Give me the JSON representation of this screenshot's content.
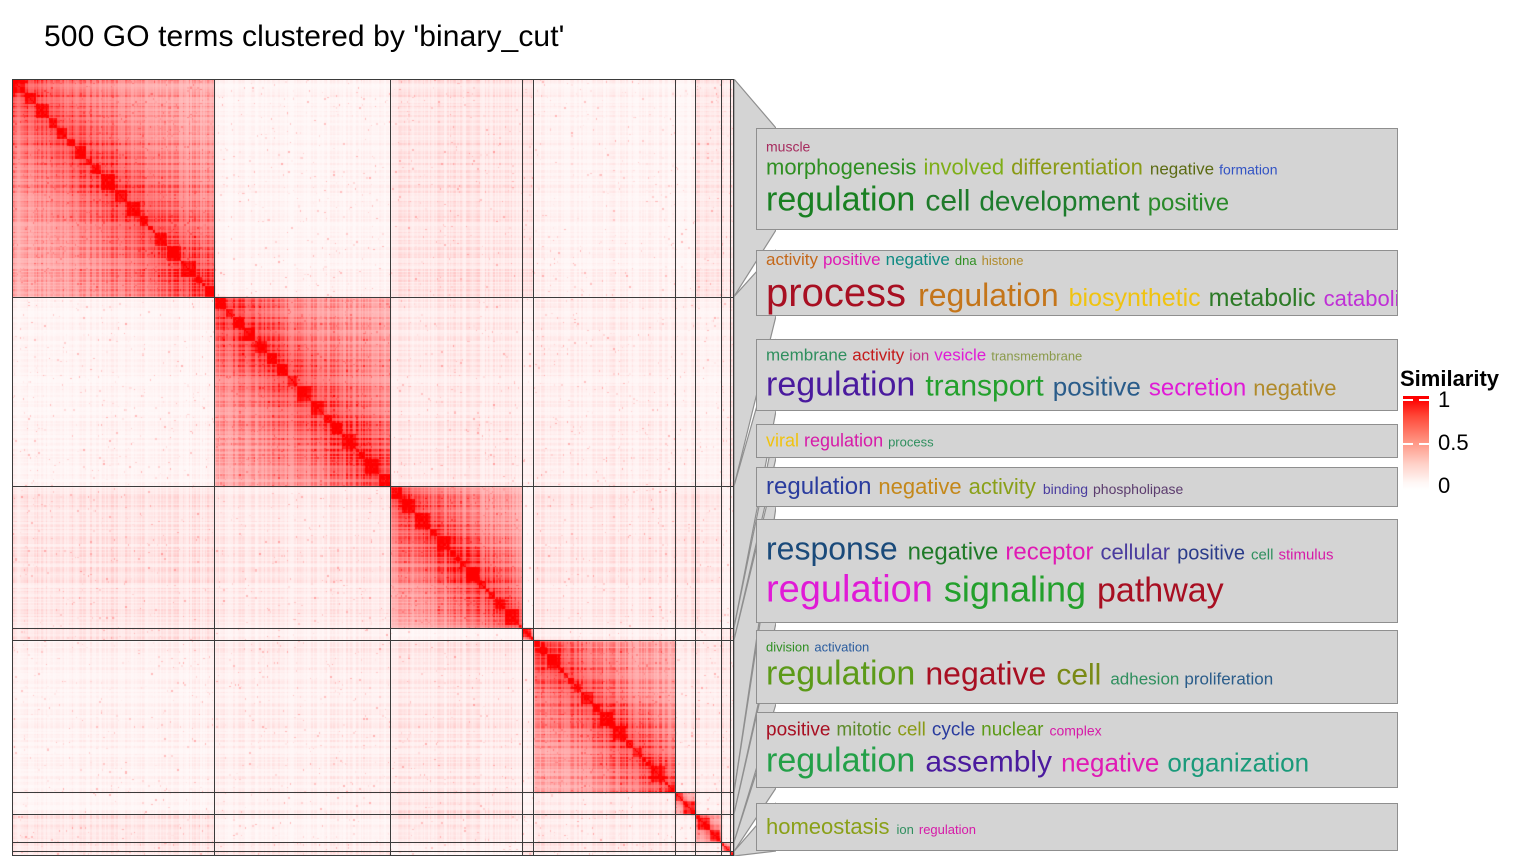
{
  "title": "500 GO terms clustered by 'binary_cut'",
  "legend": {
    "title": "Similarity",
    "ticks": [
      "1",
      "0.5",
      "0"
    ],
    "low_color": "#ffffff",
    "high_color": "#fe0000"
  },
  "heatmap": {
    "n_terms": 500,
    "clustering_method": "binary_cut",
    "cluster_sizes": [
      140,
      122,
      91,
      8,
      98,
      14,
      18,
      6,
      3
    ],
    "grid_color": "#3b3b3b",
    "background": "#ffffff"
  },
  "chart_data": {
    "type": "heatmap",
    "title": "500 GO terms clustered by 'binary_cut'",
    "xlabel": "",
    "ylabel": "",
    "colorbar": {
      "label": "Similarity",
      "ticks": [
        0,
        0.5,
        1
      ],
      "range": [
        0,
        1
      ],
      "colors": [
        "#ffffff",
        "#fe0000"
      ]
    },
    "clusters": [
      {
        "id": 1,
        "size": 140,
        "start": 0,
        "end": 140
      },
      {
        "id": 2,
        "size": 122,
        "start": 140,
        "end": 262
      },
      {
        "id": 3,
        "size": 91,
        "start": 262,
        "end": 353
      },
      {
        "id": 4,
        "size": 8,
        "start": 353,
        "end": 361
      },
      {
        "id": 5,
        "size": 98,
        "start": 361,
        "end": 459
      },
      {
        "id": 6,
        "size": 14,
        "start": 459,
        "end": 473
      },
      {
        "id": 7,
        "size": 18,
        "start": 473,
        "end": 491
      },
      {
        "id": 8,
        "size": 6,
        "start": 491,
        "end": 497
      },
      {
        "id": 9,
        "size": 3,
        "start": 497,
        "end": 500
      }
    ]
  },
  "panels": [
    {
      "id": "panel-1",
      "lines": [
        [
          {
            "t": "muscle",
            "size": 14,
            "color": "#a62b5e"
          }
        ],
        [
          {
            "t": "morphogenesis",
            "size": 22,
            "color": "#2f8f22"
          },
          {
            "t": "involved",
            "size": 22,
            "color": "#7fae18"
          },
          {
            "t": "differentiation",
            "size": 22,
            "color": "#8a9a16"
          },
          {
            "t": "negative",
            "size": 17,
            "color": "#5c6b13"
          },
          {
            "t": "formation",
            "size": 14,
            "color": "#3253c4"
          }
        ],
        [
          {
            "t": "regulation",
            "size": 34,
            "color": "#198022"
          },
          {
            "t": "cell",
            "size": 30,
            "color": "#1f7a2a"
          },
          {
            "t": "development",
            "size": 28,
            "color": "#1d7c2c"
          },
          {
            "t": "positive",
            "size": 24,
            "color": "#2a8a2a"
          }
        ]
      ]
    },
    {
      "id": "panel-2",
      "lines": [
        [
          {
            "t": "activity",
            "size": 17,
            "color": "#c4681a"
          },
          {
            "t": "positive",
            "size": 17,
            "color": "#e01ab4"
          },
          {
            "t": "negative",
            "size": 17,
            "color": "#0f8a82"
          },
          {
            "t": "dna",
            "size": 13,
            "color": "#2f8f22"
          },
          {
            "t": "histone",
            "size": 13,
            "color": "#b08a2a"
          }
        ],
        [
          {
            "t": "process",
            "size": 40,
            "color": "#a80f22"
          },
          {
            "t": "regulation",
            "size": 32,
            "color": "#c4751a"
          },
          {
            "t": "biosynthetic",
            "size": 25,
            "color": "#f0c310"
          },
          {
            "t": "metabolic",
            "size": 25,
            "color": "#2c7a26"
          },
          {
            "t": "catabolic",
            "size": 22,
            "color": "#bf2fd6"
          }
        ]
      ]
    },
    {
      "id": "panel-3",
      "lines": [
        [
          {
            "t": "membrane",
            "size": 17,
            "color": "#2f8f5e"
          },
          {
            "t": "activity",
            "size": 17,
            "color": "#c41a1a"
          },
          {
            "t": "ion",
            "size": 15,
            "color": "#c42f8a"
          },
          {
            "t": "vesicle",
            "size": 17,
            "color": "#e01ad6"
          },
          {
            "t": "transmembrane",
            "size": 13,
            "color": "#8a9a4a"
          }
        ],
        [
          {
            "t": "regulation",
            "size": 34,
            "color": "#4a1a9e"
          },
          {
            "t": "transport",
            "size": 30,
            "color": "#23a02c"
          },
          {
            "t": "positive",
            "size": 26,
            "color": "#2a5c8a"
          },
          {
            "t": "secretion",
            "size": 24,
            "color": "#e01ad6"
          },
          {
            "t": "negative",
            "size": 22,
            "color": "#b08a2a"
          }
        ]
      ]
    },
    {
      "id": "panel-4",
      "lines": [
        [
          {
            "t": "viral",
            "size": 18,
            "color": "#f0c310"
          },
          {
            "t": "regulation",
            "size": 18,
            "color": "#d61aa8"
          },
          {
            "t": "process",
            "size": 13,
            "color": "#2f8f5e"
          }
        ]
      ]
    },
    {
      "id": "panel-5",
      "lines": [
        [
          {
            "t": "regulation",
            "size": 24,
            "color": "#2a3c9e"
          },
          {
            "t": "negative",
            "size": 22,
            "color": "#c4881a"
          },
          {
            "t": "activity",
            "size": 22,
            "color": "#8aa018"
          },
          {
            "t": "binding",
            "size": 14,
            "color": "#4a3c9e"
          },
          {
            "t": "phospholipase",
            "size": 14,
            "color": "#5c3c6e"
          }
        ]
      ]
    },
    {
      "id": "panel-6",
      "lines": [
        [
          {
            "t": "response",
            "size": 32,
            "color": "#1a4a7a"
          },
          {
            "t": "negative",
            "size": 24,
            "color": "#1f7a28"
          },
          {
            "t": "receptor",
            "size": 24,
            "color": "#e01ab4"
          },
          {
            "t": "cellular",
            "size": 22,
            "color": "#4a3c9e"
          },
          {
            "t": "positive",
            "size": 20,
            "color": "#2a3c8a"
          },
          {
            "t": "cell",
            "size": 15,
            "color": "#2f8f5e"
          },
          {
            "t": "stimulus",
            "size": 15,
            "color": "#d61aa8"
          }
        ],
        [
          {
            "t": "regulation",
            "size": 38,
            "color": "#e01ad6"
          },
          {
            "t": "signaling",
            "size": 36,
            "color": "#23a02c"
          },
          {
            "t": "pathway",
            "size": 34,
            "color": "#a80f22"
          }
        ]
      ]
    },
    {
      "id": "panel-7",
      "lines": [
        [
          {
            "t": "division",
            "size": 13,
            "color": "#2f8f22"
          },
          {
            "t": "activation",
            "size": 13,
            "color": "#2a5c9e"
          }
        ],
        [
          {
            "t": "regulation",
            "size": 34,
            "color": "#5c9a18"
          },
          {
            "t": "negative",
            "size": 32,
            "color": "#a80f22"
          },
          {
            "t": "cell",
            "size": 30,
            "color": "#7a8a16"
          },
          {
            "t": "adhesion",
            "size": 17,
            "color": "#2f8f5e"
          },
          {
            "t": "proliferation",
            "size": 17,
            "color": "#2a5c8a"
          }
        ]
      ]
    },
    {
      "id": "panel-8",
      "lines": [
        [
          {
            "t": "positive",
            "size": 19,
            "color": "#a80f22"
          },
          {
            "t": "mitotic",
            "size": 19,
            "color": "#5c8a2a"
          },
          {
            "t": "cell",
            "size": 19,
            "color": "#8a9a16"
          },
          {
            "t": "cycle",
            "size": 19,
            "color": "#2a3c9e"
          },
          {
            "t": "nuclear",
            "size": 19,
            "color": "#5c9a18"
          },
          {
            "t": "complex",
            "size": 14,
            "color": "#d61aa8"
          }
        ],
        [
          {
            "t": "regulation",
            "size": 34,
            "color": "#23a048"
          },
          {
            "t": "assembly",
            "size": 30,
            "color": "#4a1a9e"
          },
          {
            "t": "negative",
            "size": 26,
            "color": "#e01ab4"
          },
          {
            "t": "organization",
            "size": 26,
            "color": "#1a9a7a"
          }
        ]
      ]
    },
    {
      "id": "panel-9",
      "lines": [
        [
          {
            "t": "homeostasis",
            "size": 22,
            "color": "#8aa018"
          },
          {
            "t": "ion",
            "size": 13,
            "color": "#2f8f5e"
          },
          {
            "t": "regulation",
            "size": 13,
            "color": "#d61aa8"
          }
        ]
      ]
    }
  ]
}
